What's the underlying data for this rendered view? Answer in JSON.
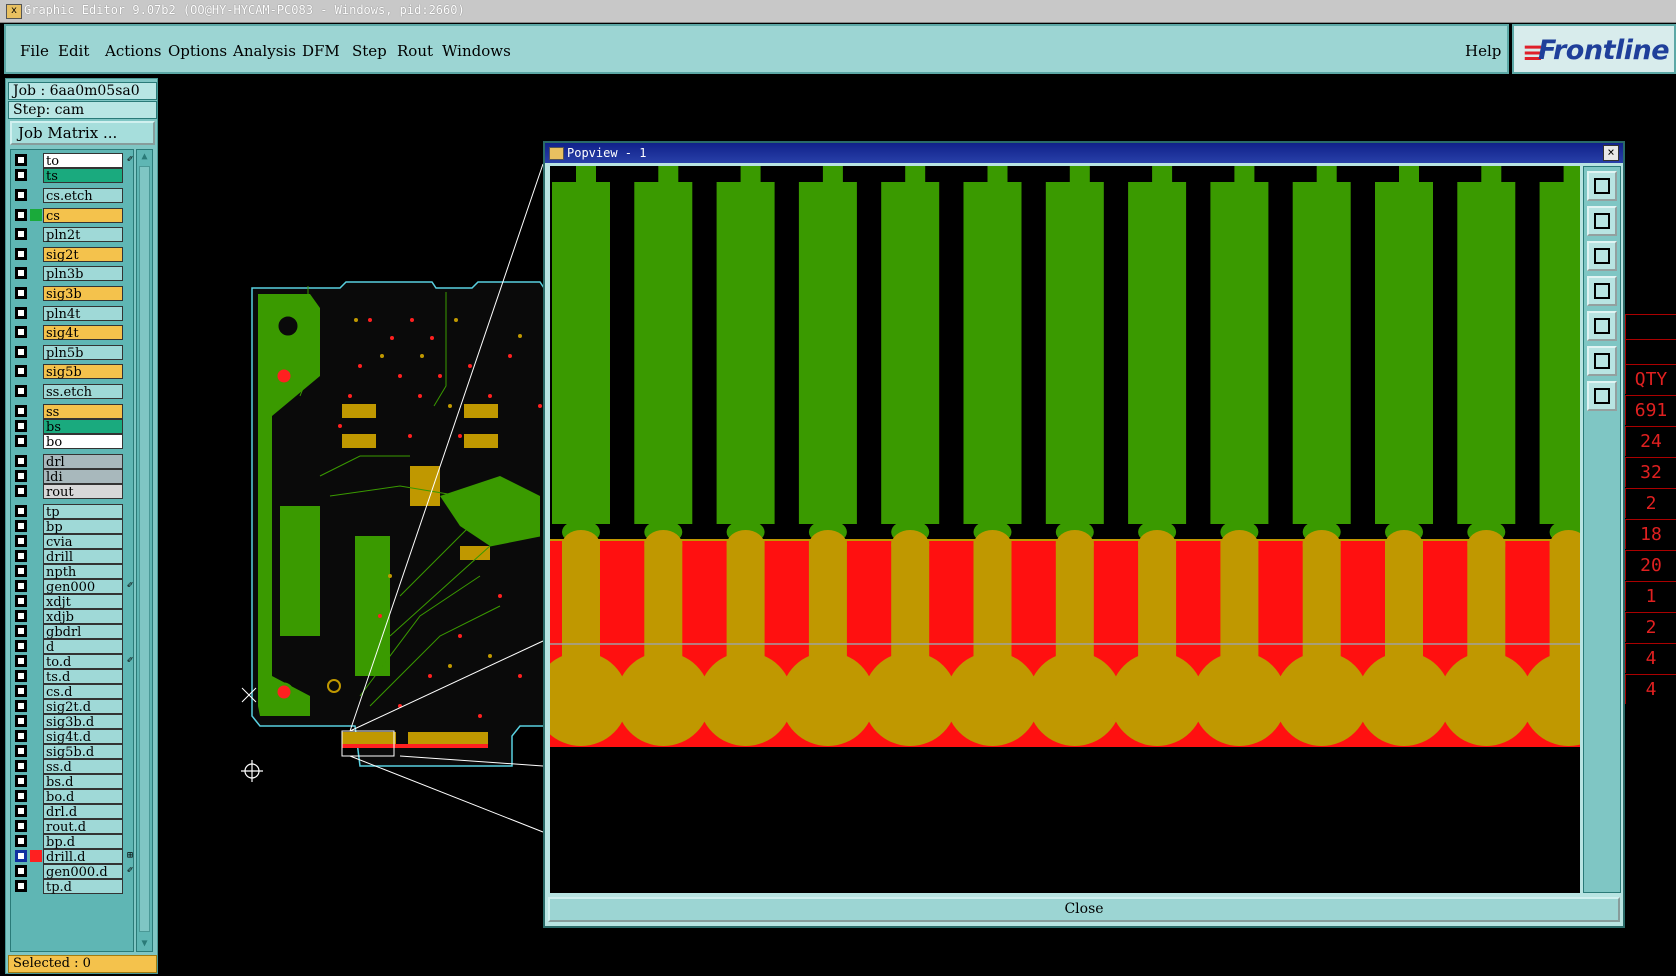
{
  "window": {
    "title": "Graphic Editor 9.07b2 (OO@HY-HYCAM-PC083 - Windows, pid:2660)"
  },
  "menu": {
    "items": [
      "File",
      "Edit",
      "Actions",
      "Options",
      "Analysis",
      "DFM",
      "Step",
      "Rout",
      "Windows"
    ],
    "help": "Help"
  },
  "brand": {
    "name": "Frontline",
    "mark": "≡"
  },
  "panel": {
    "job": "Job : 6aa0m05sa0",
    "step": "Step: cam",
    "job_matrix": "Job Matrix ...",
    "selected": "Selected : 0"
  },
  "layers": [
    {
      "name": "to",
      "color": "#ffffff",
      "mark": "✐"
    },
    {
      "name": "ts",
      "color": "#1aaa7e",
      "mark": ""
    },
    {
      "name": "cs.etch",
      "color": "#9fd9d7",
      "mark": ""
    },
    {
      "name": "cs",
      "color": "#f4c24c",
      "mark": "",
      "swatch": "#1aaa3a"
    },
    {
      "name": "pln2t",
      "color": "#9fd9d7",
      "mark": ""
    },
    {
      "name": "sig2t",
      "color": "#f4c24c",
      "mark": ""
    },
    {
      "name": "pln3b",
      "color": "#9fd9d7",
      "mark": ""
    },
    {
      "name": "sig3b",
      "color": "#f4c24c",
      "mark": ""
    },
    {
      "name": "pln4t",
      "color": "#9fd9d7",
      "mark": ""
    },
    {
      "name": "sig4t",
      "color": "#f4c24c",
      "mark": ""
    },
    {
      "name": "pln5b",
      "color": "#9fd9d7",
      "mark": ""
    },
    {
      "name": "sig5b",
      "color": "#f4c24c",
      "mark": ""
    },
    {
      "name": "ss.etch",
      "color": "#9fd9d7",
      "mark": ""
    },
    {
      "name": "ss",
      "color": "#f4c24c",
      "mark": ""
    },
    {
      "name": "bs",
      "color": "#1aaa7e",
      "mark": ""
    },
    {
      "name": "bo",
      "color": "#ffffff",
      "mark": ""
    },
    {
      "name": "drl",
      "color": "#a8b8bc",
      "mark": ""
    },
    {
      "name": "ldi",
      "color": "#a8b8bc",
      "mark": ""
    },
    {
      "name": "rout",
      "color": "#d8d8d8",
      "mark": ""
    },
    {
      "name": "tp",
      "color": "#9fd9d7",
      "mark": ""
    },
    {
      "name": "bp",
      "color": "#9fd9d7",
      "mark": ""
    },
    {
      "name": "cvia",
      "color": "#9fd9d7",
      "mark": ""
    },
    {
      "name": "drill",
      "color": "#9fd9d7",
      "mark": ""
    },
    {
      "name": "npth",
      "color": "#9fd9d7",
      "mark": ""
    },
    {
      "name": "gen000",
      "color": "#9fd9d7",
      "mark": "✐"
    },
    {
      "name": "xdjt",
      "color": "#9fd9d7",
      "mark": ""
    },
    {
      "name": "xdjb",
      "color": "#9fd9d7",
      "mark": ""
    },
    {
      "name": "gbdrl",
      "color": "#9fd9d7",
      "mark": ""
    },
    {
      "name": "d",
      "color": "#9fd9d7",
      "mark": ""
    },
    {
      "name": "to.d",
      "color": "#9fd9d7",
      "mark": "✐"
    },
    {
      "name": "ts.d",
      "color": "#9fd9d7",
      "mark": ""
    },
    {
      "name": "cs.d",
      "color": "#9fd9d7",
      "mark": ""
    },
    {
      "name": "sig2t.d",
      "color": "#9fd9d7",
      "mark": ""
    },
    {
      "name": "sig3b.d",
      "color": "#9fd9d7",
      "mark": ""
    },
    {
      "name": "sig4t.d",
      "color": "#9fd9d7",
      "mark": ""
    },
    {
      "name": "sig5b.d",
      "color": "#9fd9d7",
      "mark": ""
    },
    {
      "name": "ss.d",
      "color": "#9fd9d7",
      "mark": ""
    },
    {
      "name": "bs.d",
      "color": "#9fd9d7",
      "mark": ""
    },
    {
      "name": "bo.d",
      "color": "#9fd9d7",
      "mark": ""
    },
    {
      "name": "drl.d",
      "color": "#9fd9d7",
      "mark": ""
    },
    {
      "name": "rout.d",
      "color": "#9fd9d7",
      "mark": ""
    },
    {
      "name": "bp.d",
      "color": "#9fd9d7",
      "mark": ""
    },
    {
      "name": "drill.d",
      "color": "#9fd9d7",
      "mark": "⊞",
      "swatch": "#ff2020",
      "checked": true
    },
    {
      "name": "gen000.d",
      "color": "#9fd9d7",
      "mark": "✐"
    },
    {
      "name": "tp.d",
      "color": "#9fd9d7",
      "mark": ""
    }
  ],
  "popview": {
    "title": "Popview - 1",
    "close_x": "×",
    "close_label": "Close",
    "tools": [
      "zoom-home-icon",
      "pan-up-icon",
      "pan-down-icon",
      "pan-left-icon",
      "pan-right-icon",
      "zoom-fit-icon",
      "zoom-vertical-icon"
    ]
  },
  "right_table": [
    "QTY",
    "691",
    "24",
    "32",
    "2",
    "18",
    "20",
    "1",
    "2",
    "4",
    "4"
  ],
  "colors": {
    "copper_green": "#3a9a00",
    "red_mask": "#ff1010",
    "overlap_gold": "#c09800",
    "ui_teal": "#9cd5d3",
    "board_outline": "#59d0e0"
  }
}
